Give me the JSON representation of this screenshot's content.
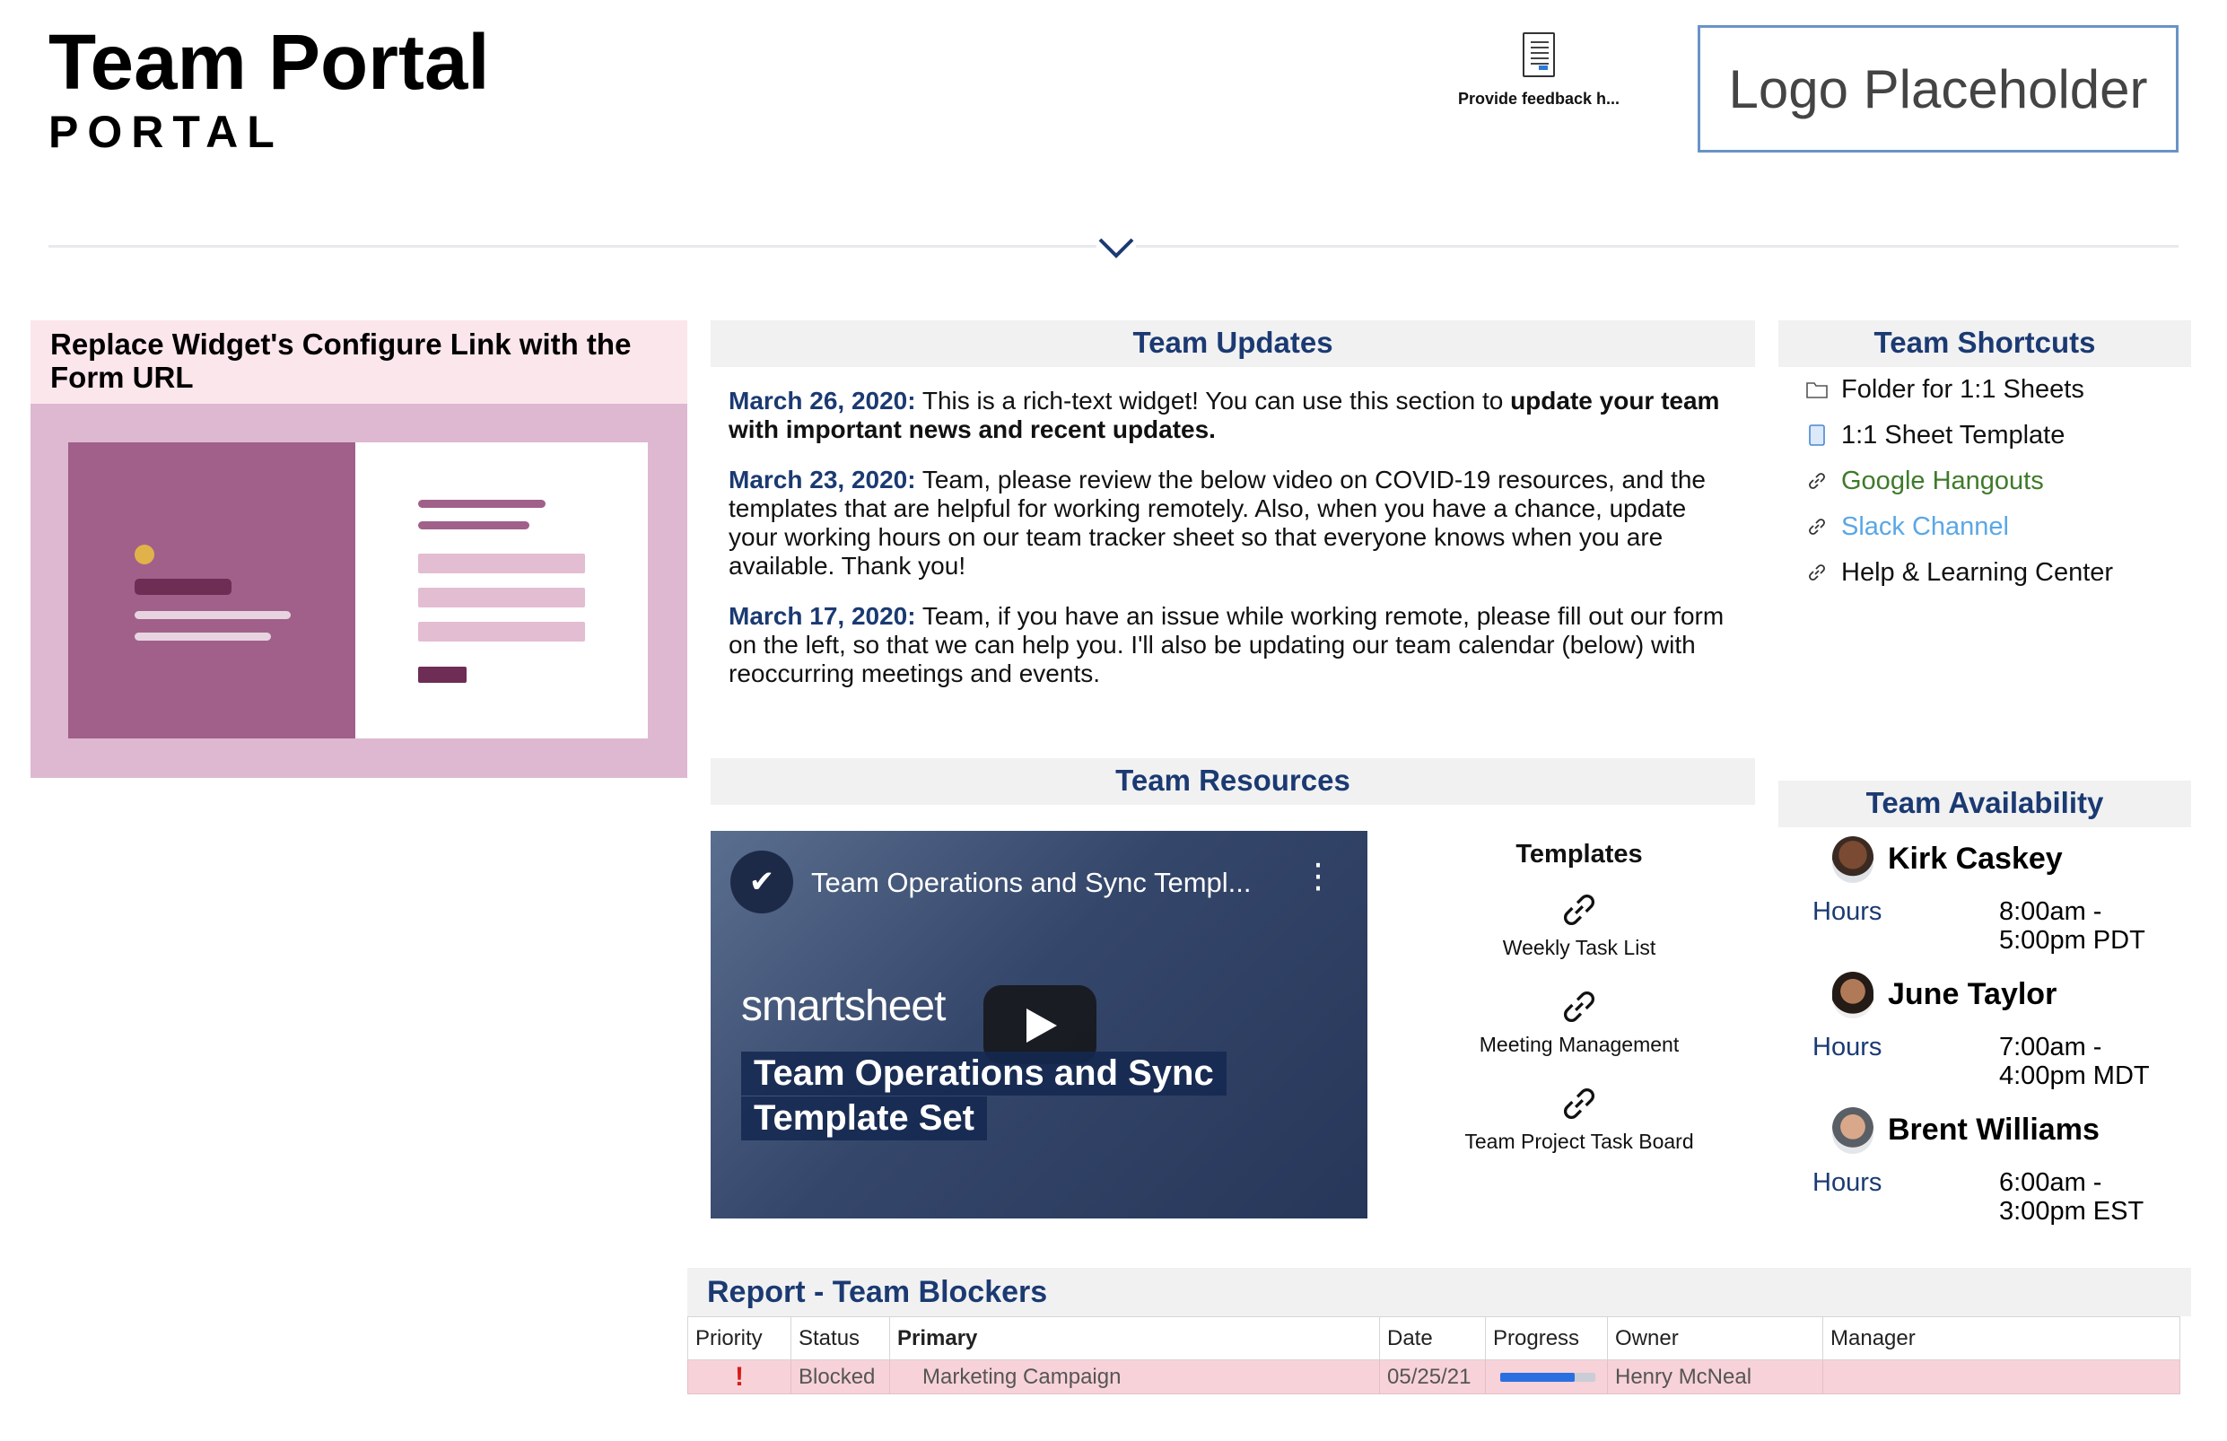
{
  "header": {
    "title": "Team Portal",
    "subtitle": "PORTAL",
    "feedback_label": "Provide feedback h...",
    "logo_text": "Logo Placeholder"
  },
  "form_widget": {
    "title": "Replace Widget's Configure Link with the Form URL"
  },
  "team_updates": {
    "title": "Team Updates",
    "entries": [
      {
        "date": "March 26, 2020:",
        "text_before": " This is a rich-text widget! You can use this section to ",
        "highlight": "update your team with important news and recent updates.",
        "text_after": ""
      },
      {
        "date": "March 23, 2020:",
        "text_before": " Team, please review the below video on COVID-19 resources, and the templates that are helpful for working remotely. Also, when you have a chance, update your working hours on our team tracker sheet so that everyone knows when you are available. Thank you!",
        "highlight": "",
        "text_after": ""
      },
      {
        "date": "March 17, 2020:",
        "text_before": " Team, if you have an issue while working remote, please fill out our form on the left, so that we can help you. I'll also be updating our team calendar (below) with reoccurring meetings and events.",
        "highlight": "",
        "text_after": ""
      }
    ]
  },
  "team_shortcuts": {
    "title": "Team Shortcuts",
    "items": [
      {
        "label": "Folder for 1:1 Sheets",
        "icon": "folder-icon",
        "color": "#111111"
      },
      {
        "label": "1:1 Sheet Template",
        "icon": "sheet-icon",
        "color": "#111111"
      },
      {
        "label": "Google Hangouts",
        "icon": "link-icon",
        "color": "#3f7a2a"
      },
      {
        "label": "Slack Channel",
        "icon": "link-icon",
        "color": "#5aa7e6"
      },
      {
        "label": "Help & Learning Center",
        "icon": "link-icon",
        "color": "#111111"
      }
    ]
  },
  "team_resources": {
    "title": "Team Resources",
    "video": {
      "title": "Team Operations and Sync Templ...",
      "brand": "smartsheet",
      "caption_line1": "Team Operations and Sync",
      "caption_line2": "Template Set"
    },
    "templates": {
      "heading": "Templates",
      "items": [
        "Weekly Task List",
        "Meeting Management",
        "Team Project Task Board"
      ]
    }
  },
  "team_availability": {
    "title": "Team Availability",
    "people": [
      {
        "name": "Kirk Caskey",
        "hours_label": "Hours",
        "hours": "8:00am - 5:00pm PDT"
      },
      {
        "name": "June Taylor",
        "hours_label": "Hours",
        "hours": "7:00am - 4:00pm MDT"
      },
      {
        "name": "Brent Williams",
        "hours_label": "Hours",
        "hours": "6:00am - 3:00pm EST"
      }
    ]
  },
  "report": {
    "title": "Report - Team Blockers",
    "columns": [
      "Priority",
      "Status",
      "Primary",
      "Date",
      "Progress",
      "Owner",
      "Manager"
    ],
    "rows": [
      {
        "priority": "!",
        "status": "Blocked",
        "primary": "Marketing Campaign",
        "date": "05/25/21",
        "progress": 0.78,
        "owner": "Henry McNeal",
        "manager": ""
      }
    ]
  },
  "colors": {
    "accent": "#1b3a72",
    "form_bg": "#ddb8d0",
    "form_header_bg": "#fbe6eb",
    "row_highlight": "#f7d2d8",
    "progress": "#2a6fe0"
  }
}
